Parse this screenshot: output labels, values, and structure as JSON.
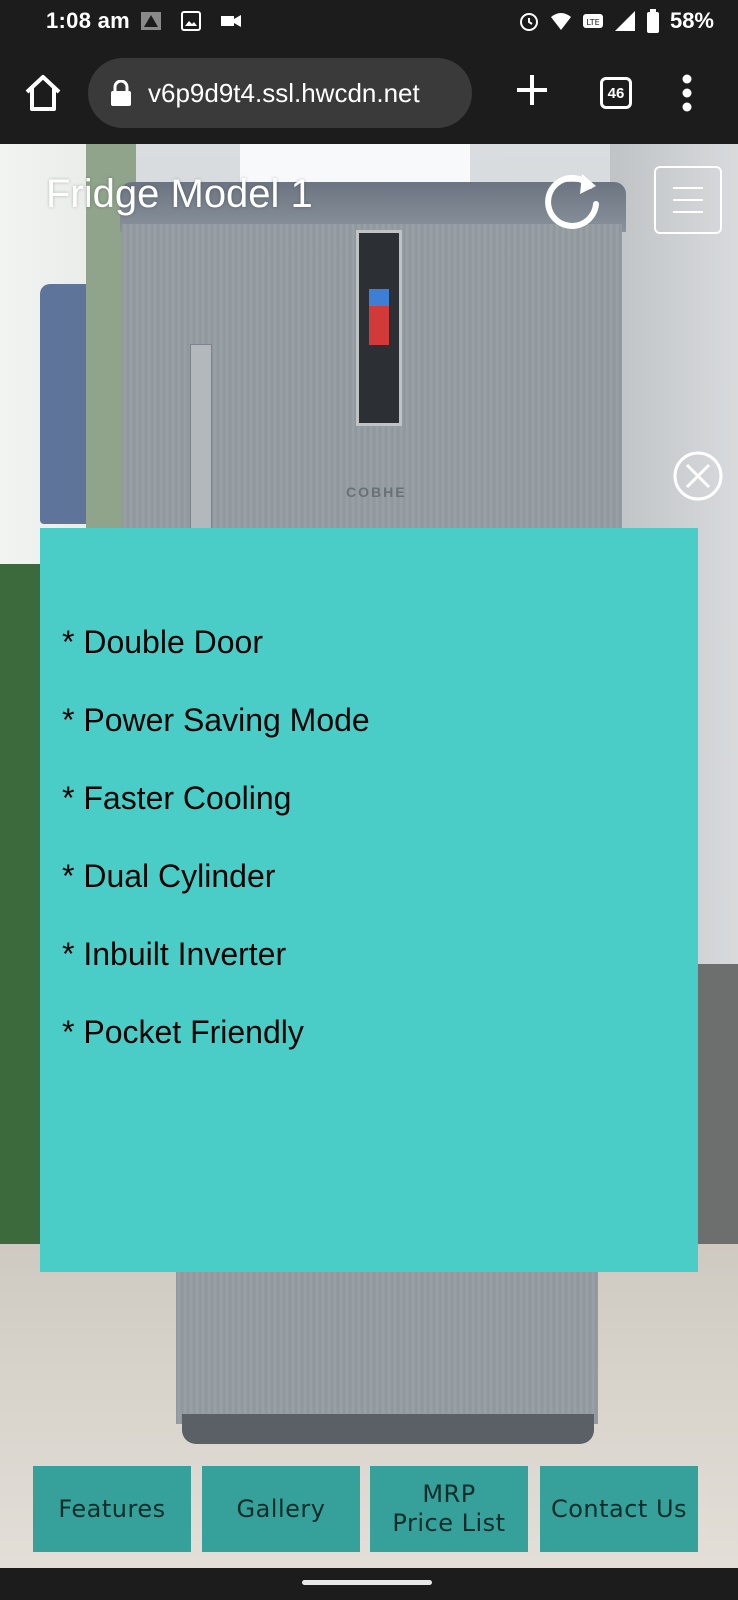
{
  "status_bar": {
    "time": "1:08 am",
    "battery_percent": "58%",
    "icons_left": [
      "alert-triangle-icon",
      "image-icon",
      "video-camera-icon"
    ],
    "icons_right": [
      "alarm-icon",
      "wifi-icon",
      "volte-icon",
      "signal-icon",
      "battery-icon"
    ]
  },
  "browser": {
    "url": "v6p9d9t4.ssl.hwcdn.net",
    "tab_count": "46"
  },
  "page": {
    "title": "Fridge Model 1",
    "fridge_brand": "COBHE"
  },
  "features": [
    "* Double Door",
    "* Power Saving Mode",
    "* Faster Cooling",
    "* Dual Cylinder",
    "* Inbuilt Inverter",
    "* Pocket Friendly"
  ],
  "nav": {
    "features": "Features",
    "gallery": "Gallery",
    "mrp_line1": "MRP",
    "mrp_line2": "Price List",
    "contact": "Contact Us"
  },
  "colors": {
    "panel": "#4acdc6",
    "nav_button": "#35a19a",
    "chrome": "#1c1c1c"
  }
}
